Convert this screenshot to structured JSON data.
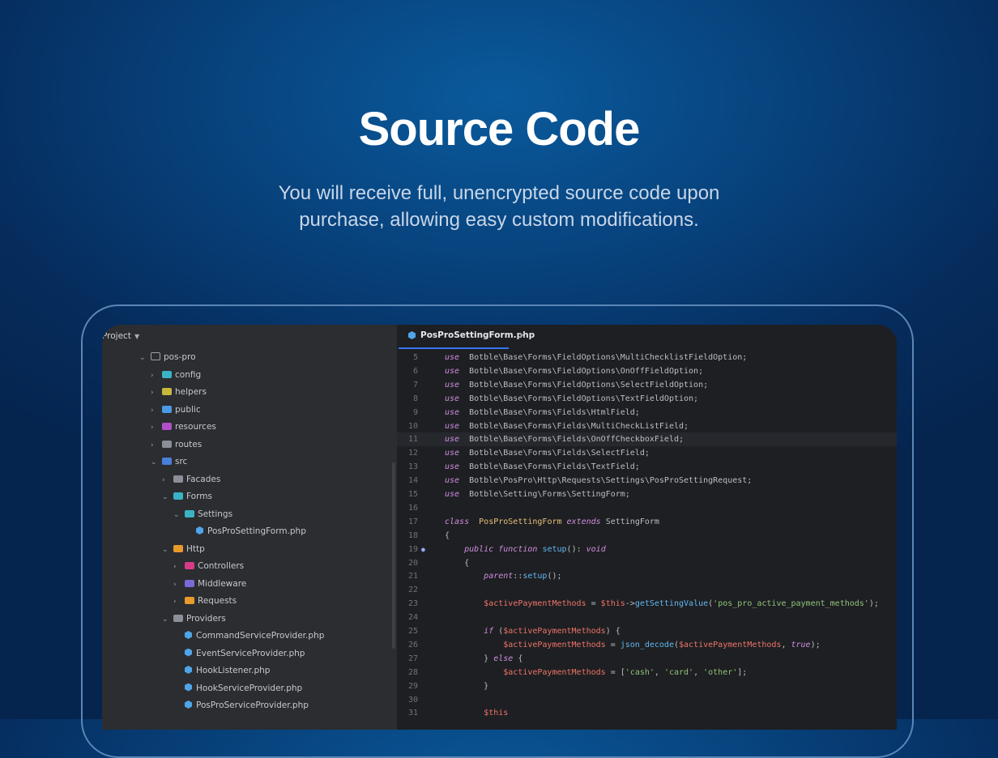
{
  "hero": {
    "title": "Source Code",
    "subtitle_line1": "You will receive full, unencrypted  source code upon",
    "subtitle_line2": "purchase, allowing easy custom modifications."
  },
  "colors": {
    "background": "#073f78",
    "screen": "#1e1f22",
    "project_panel": "#2b2d30",
    "tab_accent": "#3574f0"
  },
  "project": {
    "header": "Project",
    "tree": [
      {
        "label": "pos-pro",
        "expanded": true,
        "icon": "folder-icon"
      },
      {
        "label": "config",
        "expanded": false,
        "icon": "folder-icon",
        "color": "#3ab3c6"
      },
      {
        "label": "helpers",
        "expanded": false,
        "icon": "folder-icon",
        "color": "#c7b83a"
      },
      {
        "label": "public",
        "expanded": false,
        "icon": "folder-icon",
        "color": "#4a9ae8"
      },
      {
        "label": "resources",
        "expanded": false,
        "icon": "folder-icon",
        "color": "#b050c8"
      },
      {
        "label": "routes",
        "expanded": false,
        "icon": "folder-icon",
        "color": "#8a8f98"
      },
      {
        "label": "src",
        "expanded": true,
        "icon": "folder-icon",
        "color": "#4a7fd8"
      },
      {
        "label": "Facades",
        "expanded": false,
        "icon": "folder-icon",
        "color": "#8a8f98"
      },
      {
        "label": "Forms",
        "expanded": true,
        "icon": "folder-icon",
        "color": "#3ab3c6"
      },
      {
        "label": "Settings",
        "expanded": true,
        "icon": "folder-icon",
        "color": "#3ab3c6"
      },
      {
        "label": "PosProSettingForm.php",
        "icon": "php-file-icon"
      },
      {
        "label": "Http",
        "expanded": true,
        "icon": "folder-icon",
        "color": "#e89a2a"
      },
      {
        "label": "Controllers",
        "expanded": false,
        "icon": "folder-icon",
        "color": "#d83a8a"
      },
      {
        "label": "Middleware",
        "expanded": false,
        "icon": "folder-icon",
        "color": "#7a6ad8"
      },
      {
        "label": "Requests",
        "expanded": false,
        "icon": "folder-icon",
        "color": "#e89a2a"
      },
      {
        "label": "Providers",
        "expanded": true,
        "icon": "folder-icon",
        "color": "#8a8f98"
      },
      {
        "label": "CommandServiceProvider.php",
        "icon": "php-file-icon"
      },
      {
        "label": "EventServiceProvider.php",
        "icon": "php-file-icon"
      },
      {
        "label": "HookListener.php",
        "icon": "php-file-icon"
      },
      {
        "label": "HookServiceProvider.php",
        "icon": "php-file-icon"
      },
      {
        "label": "PosProServiceProvider.php",
        "icon": "php-file-icon"
      }
    ]
  },
  "editor": {
    "tab_label": "PosProSettingForm.php",
    "tab_close": "×",
    "current_line": "11",
    "lines": [
      {
        "n": "5",
        "parts": [
          [
            "kw",
            "use"
          ],
          [
            "",
            "  Botble\\Base\\Forms\\FieldOptions\\MultiChecklistFieldOption;"
          ]
        ]
      },
      {
        "n": "6",
        "parts": [
          [
            "kw",
            "use"
          ],
          [
            "",
            "  Botble\\Base\\Forms\\FieldOptions\\OnOffFieldOption;"
          ]
        ]
      },
      {
        "n": "7",
        "parts": [
          [
            "kw",
            "use"
          ],
          [
            "",
            "  Botble\\Base\\Forms\\FieldOptions\\SelectFieldOption;"
          ]
        ]
      },
      {
        "n": "8",
        "parts": [
          [
            "kw",
            "use"
          ],
          [
            "",
            "  Botble\\Base\\Forms\\FieldOptions\\TextFieldOption;"
          ]
        ]
      },
      {
        "n": "9",
        "parts": [
          [
            "kw",
            "use"
          ],
          [
            "",
            "  Botble\\Base\\Forms\\Fields\\HtmlField;"
          ]
        ]
      },
      {
        "n": "10",
        "parts": [
          [
            "kw",
            "use"
          ],
          [
            "",
            "  Botble\\Base\\Forms\\Fields\\MultiCheckListField;"
          ]
        ]
      },
      {
        "n": "11",
        "parts": [
          [
            "kw",
            "use"
          ],
          [
            "",
            "  Botble\\Base\\Forms\\Fields\\OnOffCheckboxField;"
          ]
        ]
      },
      {
        "n": "12",
        "parts": [
          [
            "kw",
            "use"
          ],
          [
            "",
            "  Botble\\Base\\Forms\\Fields\\SelectField;"
          ]
        ]
      },
      {
        "n": "13",
        "parts": [
          [
            "kw",
            "use"
          ],
          [
            "",
            "  Botble\\Base\\Forms\\Fields\\TextField;"
          ]
        ]
      },
      {
        "n": "14",
        "parts": [
          [
            "kw",
            "use"
          ],
          [
            "",
            "  Botble\\PosPro\\Http\\Requests\\Settings\\PosProSettingRequest;"
          ]
        ]
      },
      {
        "n": "15",
        "parts": [
          [
            "kw",
            "use"
          ],
          [
            "",
            "  Botble\\Setting\\Forms\\SettingForm;"
          ]
        ]
      },
      {
        "n": "16",
        "parts": []
      },
      {
        "n": "17",
        "parts": [
          [
            "kw",
            "class"
          ],
          [
            "",
            "  "
          ],
          [
            "cls",
            "PosProSettingForm"
          ],
          [
            "",
            ""
          ],
          [
            "kw",
            " extends"
          ],
          [
            "",
            " SettingForm"
          ]
        ]
      },
      {
        "n": "18",
        "parts": [
          [
            "",
            "{"
          ]
        ]
      },
      {
        "n": "19",
        "parts": [
          [
            "",
            "    "
          ],
          [
            "kw",
            "public function"
          ],
          [
            "",
            " "
          ],
          [
            "fn",
            "setup"
          ],
          [
            "",
            "(): "
          ],
          [
            "kw",
            "void"
          ]
        ]
      },
      {
        "n": "20",
        "parts": [
          [
            "",
            "    {"
          ]
        ]
      },
      {
        "n": "21",
        "parts": [
          [
            "",
            "        "
          ],
          [
            "kw",
            "parent"
          ],
          [
            "",
            "::"
          ],
          [
            "fn",
            "setup"
          ],
          [
            "",
            "();"
          ]
        ]
      },
      {
        "n": "22",
        "parts": []
      },
      {
        "n": "23",
        "parts": [
          [
            "",
            "        "
          ],
          [
            "var",
            "$activePaymentMethods"
          ],
          [
            "",
            " = "
          ],
          [
            "var",
            "$this"
          ],
          [
            "",
            "->"
          ],
          [
            "fn",
            "getSettingValue"
          ],
          [
            "",
            "("
          ],
          [
            "str",
            "'pos_pro_active_payment_methods'"
          ],
          [
            "",
            ");"
          ]
        ]
      },
      {
        "n": "24",
        "parts": []
      },
      {
        "n": "25",
        "parts": [
          [
            "",
            "        "
          ],
          [
            "kw",
            "if"
          ],
          [
            "",
            " ("
          ],
          [
            "var",
            "$activePaymentMethods"
          ],
          [
            "",
            ") {"
          ]
        ]
      },
      {
        "n": "26",
        "parts": [
          [
            "",
            "            "
          ],
          [
            "var",
            "$activePaymentMethods"
          ],
          [
            "",
            " = "
          ],
          [
            "fn",
            "json_decode"
          ],
          [
            "",
            "("
          ],
          [
            "var",
            "$activePaymentMethods"
          ],
          [
            "",
            ", "
          ],
          [
            "kw",
            "true"
          ],
          [
            "",
            ");"
          ]
        ]
      },
      {
        "n": "27",
        "parts": [
          [
            "",
            "        } "
          ],
          [
            "kw",
            "else"
          ],
          [
            "",
            " {"
          ]
        ]
      },
      {
        "n": "28",
        "parts": [
          [
            "",
            "            "
          ],
          [
            "var",
            "$activePaymentMethods"
          ],
          [
            "",
            " = ["
          ],
          [
            "str",
            "'cash'"
          ],
          [
            "",
            ", "
          ],
          [
            "str",
            "'card'"
          ],
          [
            "",
            ", "
          ],
          [
            "str",
            "'other'"
          ],
          [
            "",
            "];"
          ]
        ]
      },
      {
        "n": "29",
        "parts": [
          [
            "",
            "        }"
          ]
        ]
      },
      {
        "n": "30",
        "parts": []
      },
      {
        "n": "31",
        "parts": [
          [
            "",
            "        "
          ],
          [
            "var",
            "$this"
          ]
        ]
      }
    ]
  }
}
